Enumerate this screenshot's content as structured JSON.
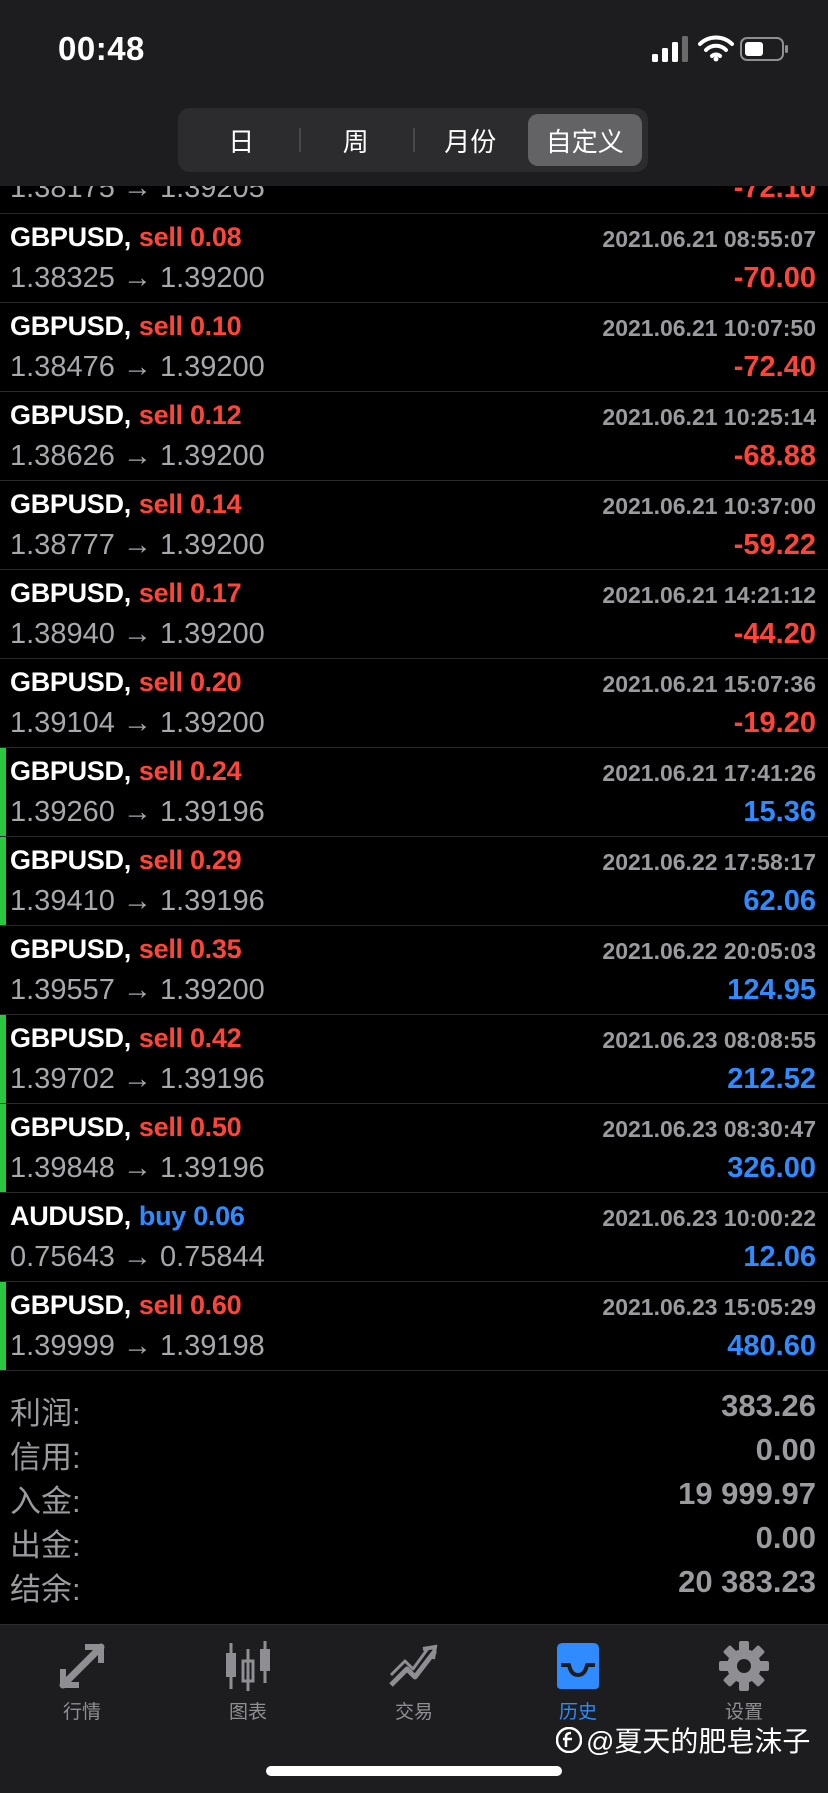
{
  "status_bar": {
    "time": "00:48"
  },
  "segments": [
    {
      "label": "日"
    },
    {
      "label": "周"
    },
    {
      "label": "月份"
    },
    {
      "label": "自定义",
      "active": true
    }
  ],
  "partial_row": {
    "prices": "1.38175 → 1.39205",
    "profit": "-72.10"
  },
  "deals": [
    {
      "symbol": "GBPUSD,",
      "side": "sell 0.08",
      "datetime": "2021.06.21 08:55:07",
      "prices": "1.38325 → 1.39200",
      "profit": "-70.00",
      "win": false,
      "dir": "sell"
    },
    {
      "symbol": "GBPUSD,",
      "side": "sell 0.10",
      "datetime": "2021.06.21 10:07:50",
      "prices": "1.38476 → 1.39200",
      "profit": "-72.40",
      "win": false,
      "dir": "sell"
    },
    {
      "symbol": "GBPUSD,",
      "side": "sell 0.12",
      "datetime": "2021.06.21 10:25:14",
      "prices": "1.38626 → 1.39200",
      "profit": "-68.88",
      "win": false,
      "dir": "sell"
    },
    {
      "symbol": "GBPUSD,",
      "side": "sell 0.14",
      "datetime": "2021.06.21 10:37:00",
      "prices": "1.38777 → 1.39200",
      "profit": "-59.22",
      "win": false,
      "dir": "sell"
    },
    {
      "symbol": "GBPUSD,",
      "side": "sell 0.17",
      "datetime": "2021.06.21 14:21:12",
      "prices": "1.38940 → 1.39200",
      "profit": "-44.20",
      "win": false,
      "dir": "sell"
    },
    {
      "symbol": "GBPUSD,",
      "side": "sell 0.20",
      "datetime": "2021.06.21 15:07:36",
      "prices": "1.39104 → 1.39200",
      "profit": "-19.20",
      "win": false,
      "dir": "sell"
    },
    {
      "symbol": "GBPUSD,",
      "side": "sell 0.24",
      "datetime": "2021.06.21 17:41:26",
      "prices": "1.39260 → 1.39196",
      "profit": "15.36",
      "win": true,
      "dir": "sell"
    },
    {
      "symbol": "GBPUSD,",
      "side": "sell 0.29",
      "datetime": "2021.06.22 17:58:17",
      "prices": "1.39410 → 1.39196",
      "profit": "62.06",
      "win": true,
      "dir": "sell"
    },
    {
      "symbol": "GBPUSD,",
      "side": "sell 0.35",
      "datetime": "2021.06.22 20:05:03",
      "prices": "1.39557 → 1.39200",
      "profit": "124.95",
      "win": false,
      "dir": "sell"
    },
    {
      "symbol": "GBPUSD,",
      "side": "sell 0.42",
      "datetime": "2021.06.23 08:08:55",
      "prices": "1.39702 → 1.39196",
      "profit": "212.52",
      "win": true,
      "dir": "sell"
    },
    {
      "symbol": "GBPUSD,",
      "side": "sell 0.50",
      "datetime": "2021.06.23 08:30:47",
      "prices": "1.39848 → 1.39196",
      "profit": "326.00",
      "win": true,
      "dir": "sell"
    },
    {
      "symbol": "AUDUSD,",
      "side": "buy 0.06",
      "datetime": "2021.06.23 10:00:22",
      "prices": "0.75643 → 0.75844",
      "profit": "12.06",
      "win": false,
      "dir": "buy"
    },
    {
      "symbol": "GBPUSD,",
      "side": "sell 0.60",
      "datetime": "2021.06.23 15:05:29",
      "prices": "1.39999 → 1.39198",
      "profit": "480.60",
      "win": true,
      "dir": "sell"
    }
  ],
  "summary": [
    {
      "label": "利润:",
      "value": "383.26"
    },
    {
      "label": "信用:",
      "value": "0.00"
    },
    {
      "label": "入金:",
      "value": "19 999.97"
    },
    {
      "label": "出金:",
      "value": "0.00"
    },
    {
      "label": "结余:",
      "value": "20 383.23"
    }
  ],
  "tabs": [
    {
      "label": "行情",
      "icon": "quotes-arrows-icon"
    },
    {
      "label": "图表",
      "icon": "candlestick-chart-icon"
    },
    {
      "label": "交易",
      "icon": "trade-trend-icon"
    },
    {
      "label": "历史",
      "icon": "history-inbox-icon",
      "active": true
    },
    {
      "label": "设置",
      "icon": "gear-icon"
    }
  ],
  "watermark": "@夏天的肥皂沫子",
  "colors": {
    "sell": "#ff453a",
    "buy": "#2f8bff",
    "win_marker": "#28c840",
    "active_tab": "#2f8bff"
  }
}
